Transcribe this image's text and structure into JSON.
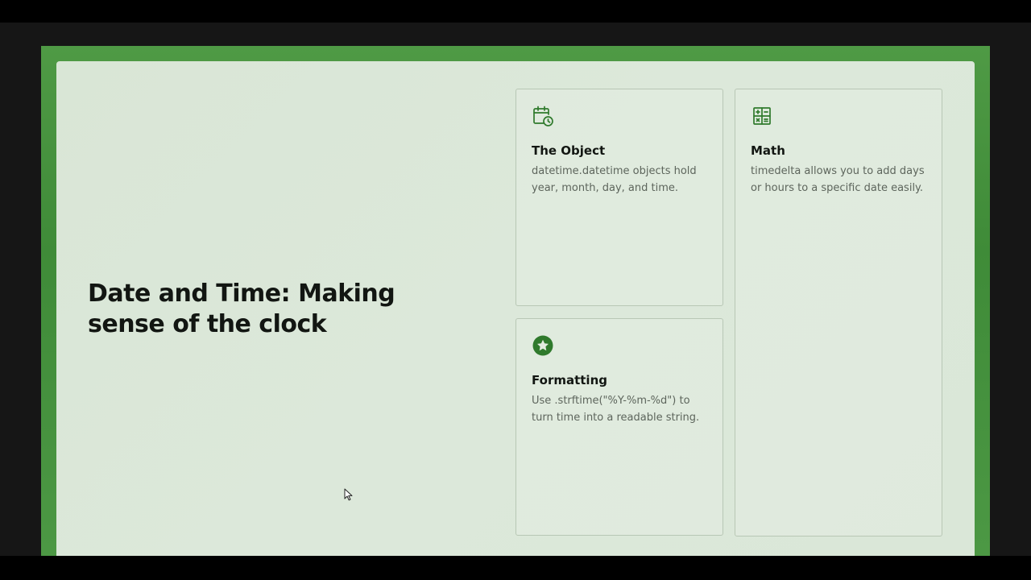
{
  "slide": {
    "title": "Date and Time: Making sense of the clock"
  },
  "cards": [
    {
      "icon": "calendar-clock-icon",
      "heading": "The Object",
      "body": "datetime.datetime objects hold year, month, day, and time."
    },
    {
      "icon": "calculator-icon",
      "heading": "Math",
      "body": "timedelta allows you to add days or hours to a specific date easily."
    },
    {
      "icon": "star-badge-icon",
      "heading": "Formatting",
      "body": "Use .strftime(\"%Y-%m-%d\") to turn time into a readable string."
    }
  ],
  "colors": {
    "frame_green": "#4f9a45",
    "slide_background": "#dae7d8",
    "icon_green": "#2f7a2c",
    "title_text": "#121612",
    "body_text": "#5d655c"
  }
}
